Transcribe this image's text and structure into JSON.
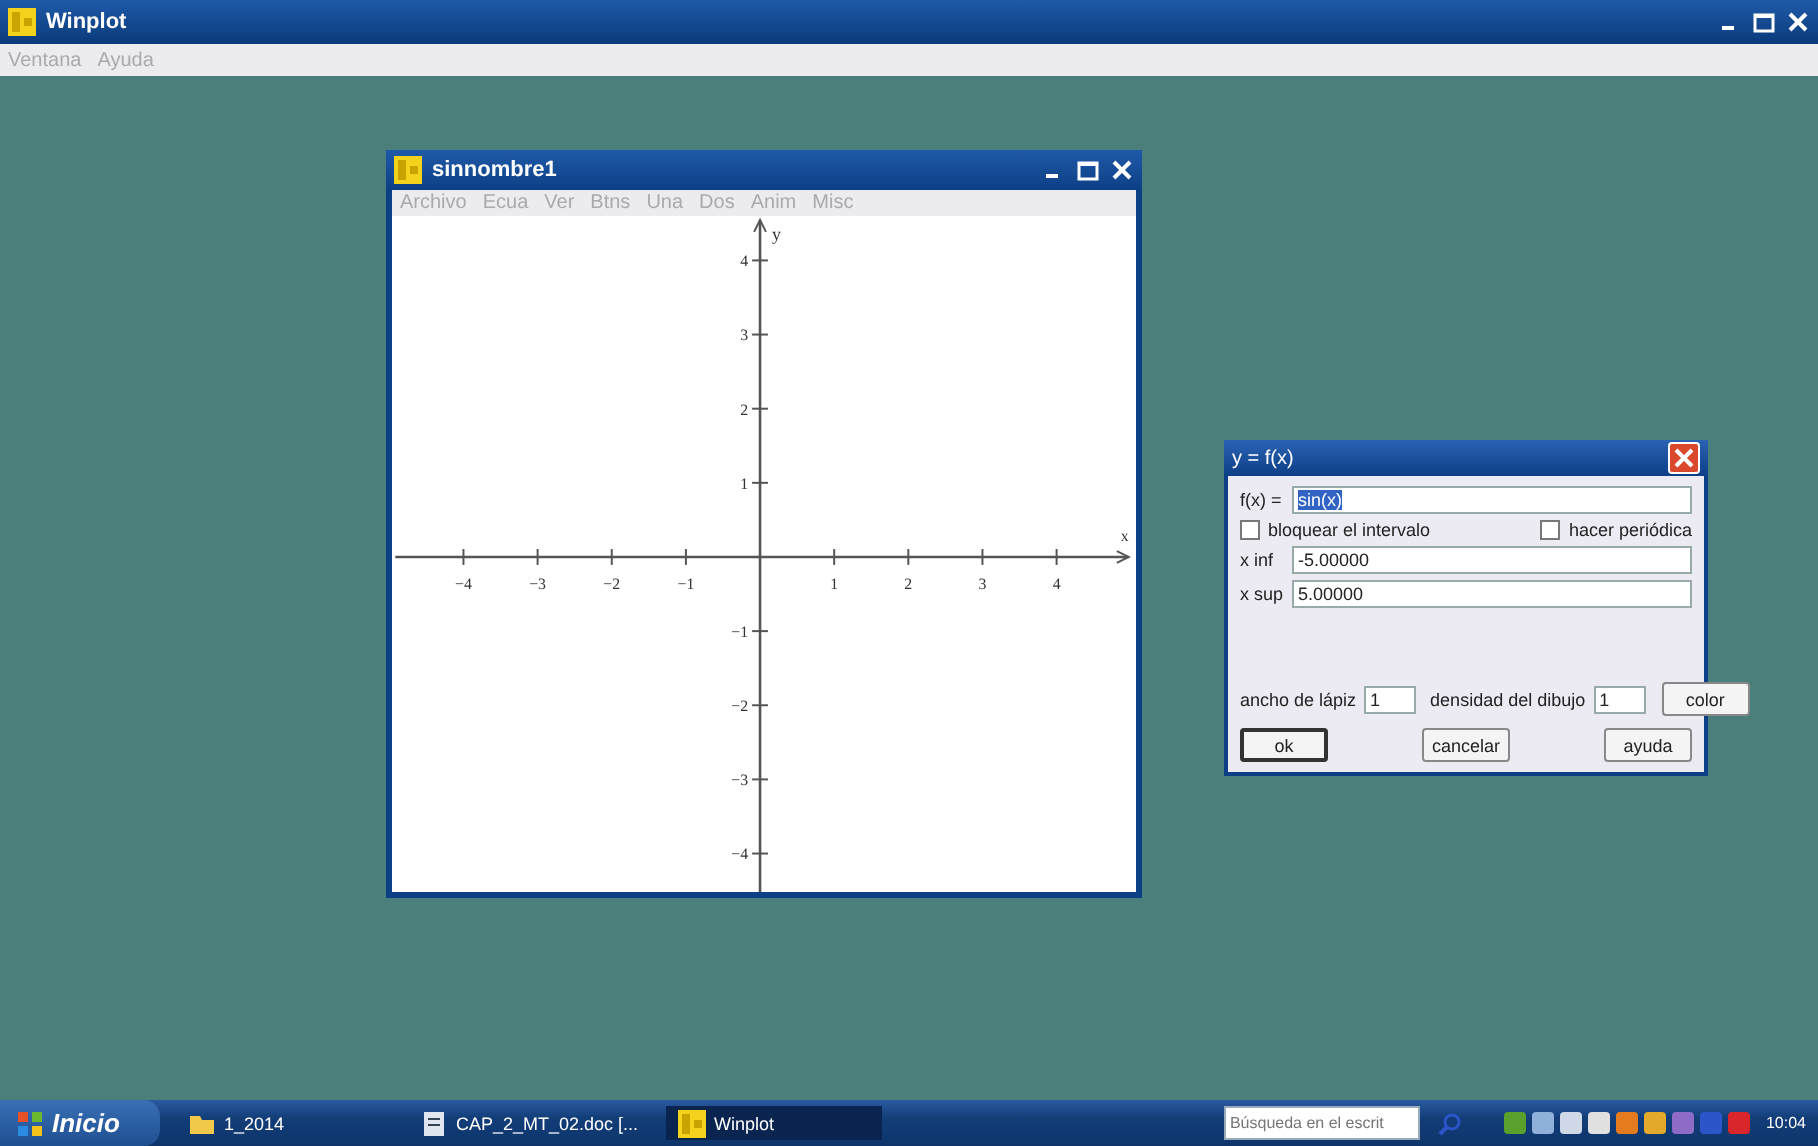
{
  "app": {
    "title": "Winplot",
    "menu": [
      {
        "label": "Ventana",
        "disabled": true
      },
      {
        "label": "Ayuda",
        "disabled": true
      }
    ]
  },
  "graph_window": {
    "title": "sinnombre1",
    "menu": [
      {
        "label": "Archivo",
        "disabled": true
      },
      {
        "label": "Ecua",
        "disabled": true
      },
      {
        "label": "Ver",
        "disabled": true
      },
      {
        "label": "Btns",
        "disabled": true
      },
      {
        "label": "Una",
        "disabled": true
      },
      {
        "label": "Dos",
        "disabled": true
      },
      {
        "label": "Anim",
        "disabled": true
      },
      {
        "label": "Misc",
        "disabled": true
      }
    ],
    "x_label": "x",
    "y_label": "y",
    "x_ticks": [
      "−4",
      "−3",
      "−2",
      "−1",
      "1",
      "2",
      "3",
      "4"
    ],
    "y_ticks": [
      "4",
      "3",
      "2",
      "1",
      "−1",
      "−2",
      "−3",
      "−4"
    ]
  },
  "dialog": {
    "title": "y = f(x)",
    "function": {
      "label": "f(x) =",
      "value": "sin(x)",
      "text_selected": true
    },
    "checkboxes": [
      {
        "label": "bloquear el intervalo",
        "checked": false
      },
      {
        "label": "hacer periódica",
        "checked": false
      }
    ],
    "fields": [
      {
        "label": "x inf",
        "value": "-5.00000"
      },
      {
        "label": "x sup",
        "value": "5.00000"
      }
    ],
    "pen_width": {
      "label": "ancho de lápiz",
      "value": "1"
    },
    "density": {
      "label": "densidad del dibujo",
      "value": "1"
    },
    "color_button": "color",
    "buttons": [
      {
        "label": "ok",
        "default": true
      },
      {
        "label": "cancelar",
        "default": false
      },
      {
        "label": "ayuda",
        "default": false
      }
    ]
  },
  "taskbar": {
    "start": "Inicio",
    "tasks": [
      {
        "label": "1_2014",
        "kind": "folder",
        "selected": false
      },
      {
        "label": "CAP_2_MT_02.doc [...",
        "kind": "document",
        "selected": false
      },
      {
        "label": "Winplot",
        "kind": "app",
        "selected": true
      }
    ],
    "search": {
      "placeholder": "Búsqueda en el escrit"
    },
    "clock": "10:04"
  }
}
